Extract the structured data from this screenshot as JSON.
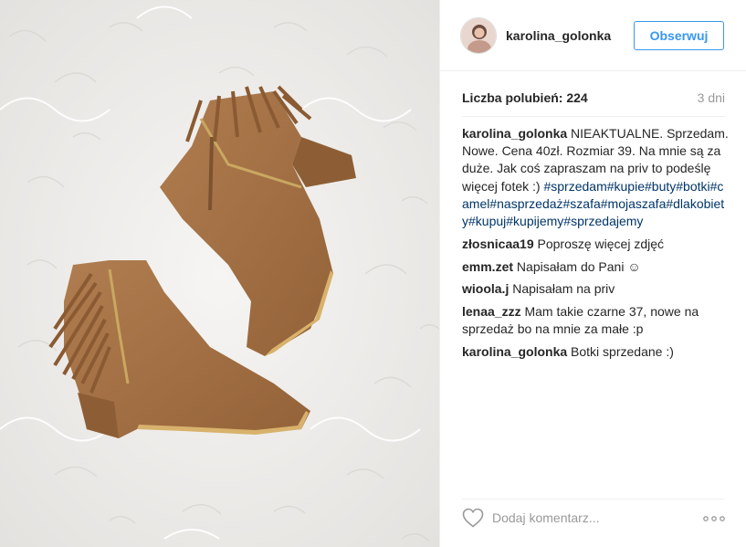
{
  "post": {
    "image_description_icon": "photo-icon",
    "colors": {
      "accent": "#3897f0",
      "hashtag": "#003569",
      "muted": "#999999",
      "boot": "#a57245",
      "fur": "#f3f1ee"
    }
  },
  "header": {
    "username": "karolina_golonka",
    "follow_label": "Obserwuj"
  },
  "meta": {
    "likes_label": "Liczba polubień: 224",
    "time": "3 dni"
  },
  "comments": [
    {
      "user": "karolina_golonka",
      "text": "NIEAKTUALNE. Sprzedam. Nowe. Cena 40zł. Rozmiar 39. Na mnie są za duże. Jak coś zapraszam na priv to podeślę więcej fotek :)",
      "hashtags": "#sprzedam#kupie#buty#botki#camel#nasprzedaż#szafa#mojaszafa#dlakobiety#kupuj#kupijemy#sprzedajemy"
    },
    {
      "user": "złosnicaa19",
      "text": "Poproszę więcej zdjęć"
    },
    {
      "user": "emm.zet",
      "text": "Napisałam do Pani ☺"
    },
    {
      "user": "wioola.j",
      "text": "Napisałam na priv"
    },
    {
      "user": "lenaa_zzz",
      "text": "Mam takie czarne 37, nowe na sprzedaż bo na mnie za małe :p"
    },
    {
      "user": "karolina_golonka",
      "text": "Botki sprzedane :)"
    }
  ],
  "footer": {
    "comment_placeholder": "Dodaj komentarz...",
    "like_icon": "heart-icon",
    "more_icon": "more-options-icon"
  }
}
